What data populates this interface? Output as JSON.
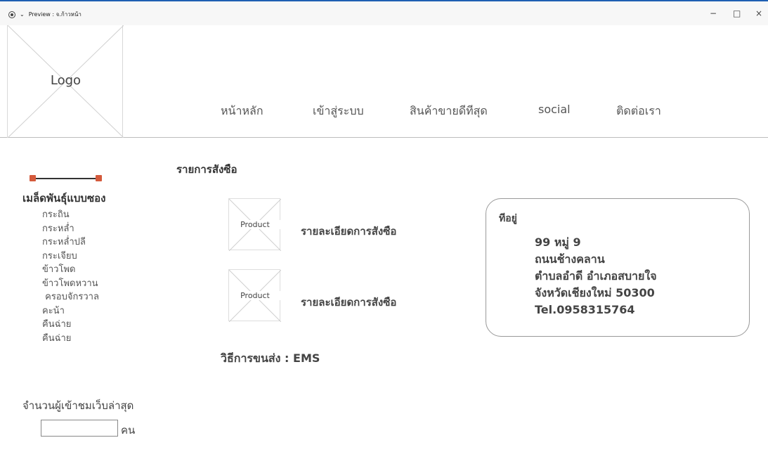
{
  "window": {
    "title": "Preview : จ.ก้าวหน้า",
    "minimize_icon": "−",
    "maximize_icon": "□",
    "close_icon": "×"
  },
  "header": {
    "logo_text": "Logo",
    "nav": [
      {
        "label": "หน้าหลัก"
      },
      {
        "label": "เข้าสู่ระบบ"
      },
      {
        "label": "สินค้าขายดีทีสุด"
      },
      {
        "label": "social"
      },
      {
        "label": "ติดต่อเรา"
      }
    ]
  },
  "sidebar": {
    "slider_value": [
      0,
      1
    ],
    "category_title": "เมล็ดพันธุ์แบบซอง",
    "categories": [
      "กระถิน",
      "กระหล่ำ",
      "กระหล่ำปลี",
      "กระเจียบ",
      "ข้าวโพด",
      "ข้าวโพดหวาน",
      " ครอบจักรวาล",
      "คะน้า",
      "คืนฉ่าย",
      "คืนฉ่าย"
    ],
    "visitor_label": "จำนวนผู้เข้าชมเว็บล่าสุด",
    "visitor_value": "",
    "visitor_unit": "คน"
  },
  "order": {
    "title": "รายการสังซือ",
    "items": [
      {
        "image_label": "Product",
        "detail": "รายละเอียดการสังซือ"
      },
      {
        "image_label": "Product",
        "detail": "รายละเอียดการสังซือ"
      }
    ],
    "shipping": "วิธีการขนส่ง : EMS"
  },
  "address": {
    "label": "ทีอยู่",
    "lines": [
      "99 หมู่ 9",
      "ถนนช้างคลาน",
      "ตำบลอำดี อำเภอสบายใจ",
      "จังหวัดเชียงใหม่ 50300",
      "Tel.0958315764"
    ]
  }
}
